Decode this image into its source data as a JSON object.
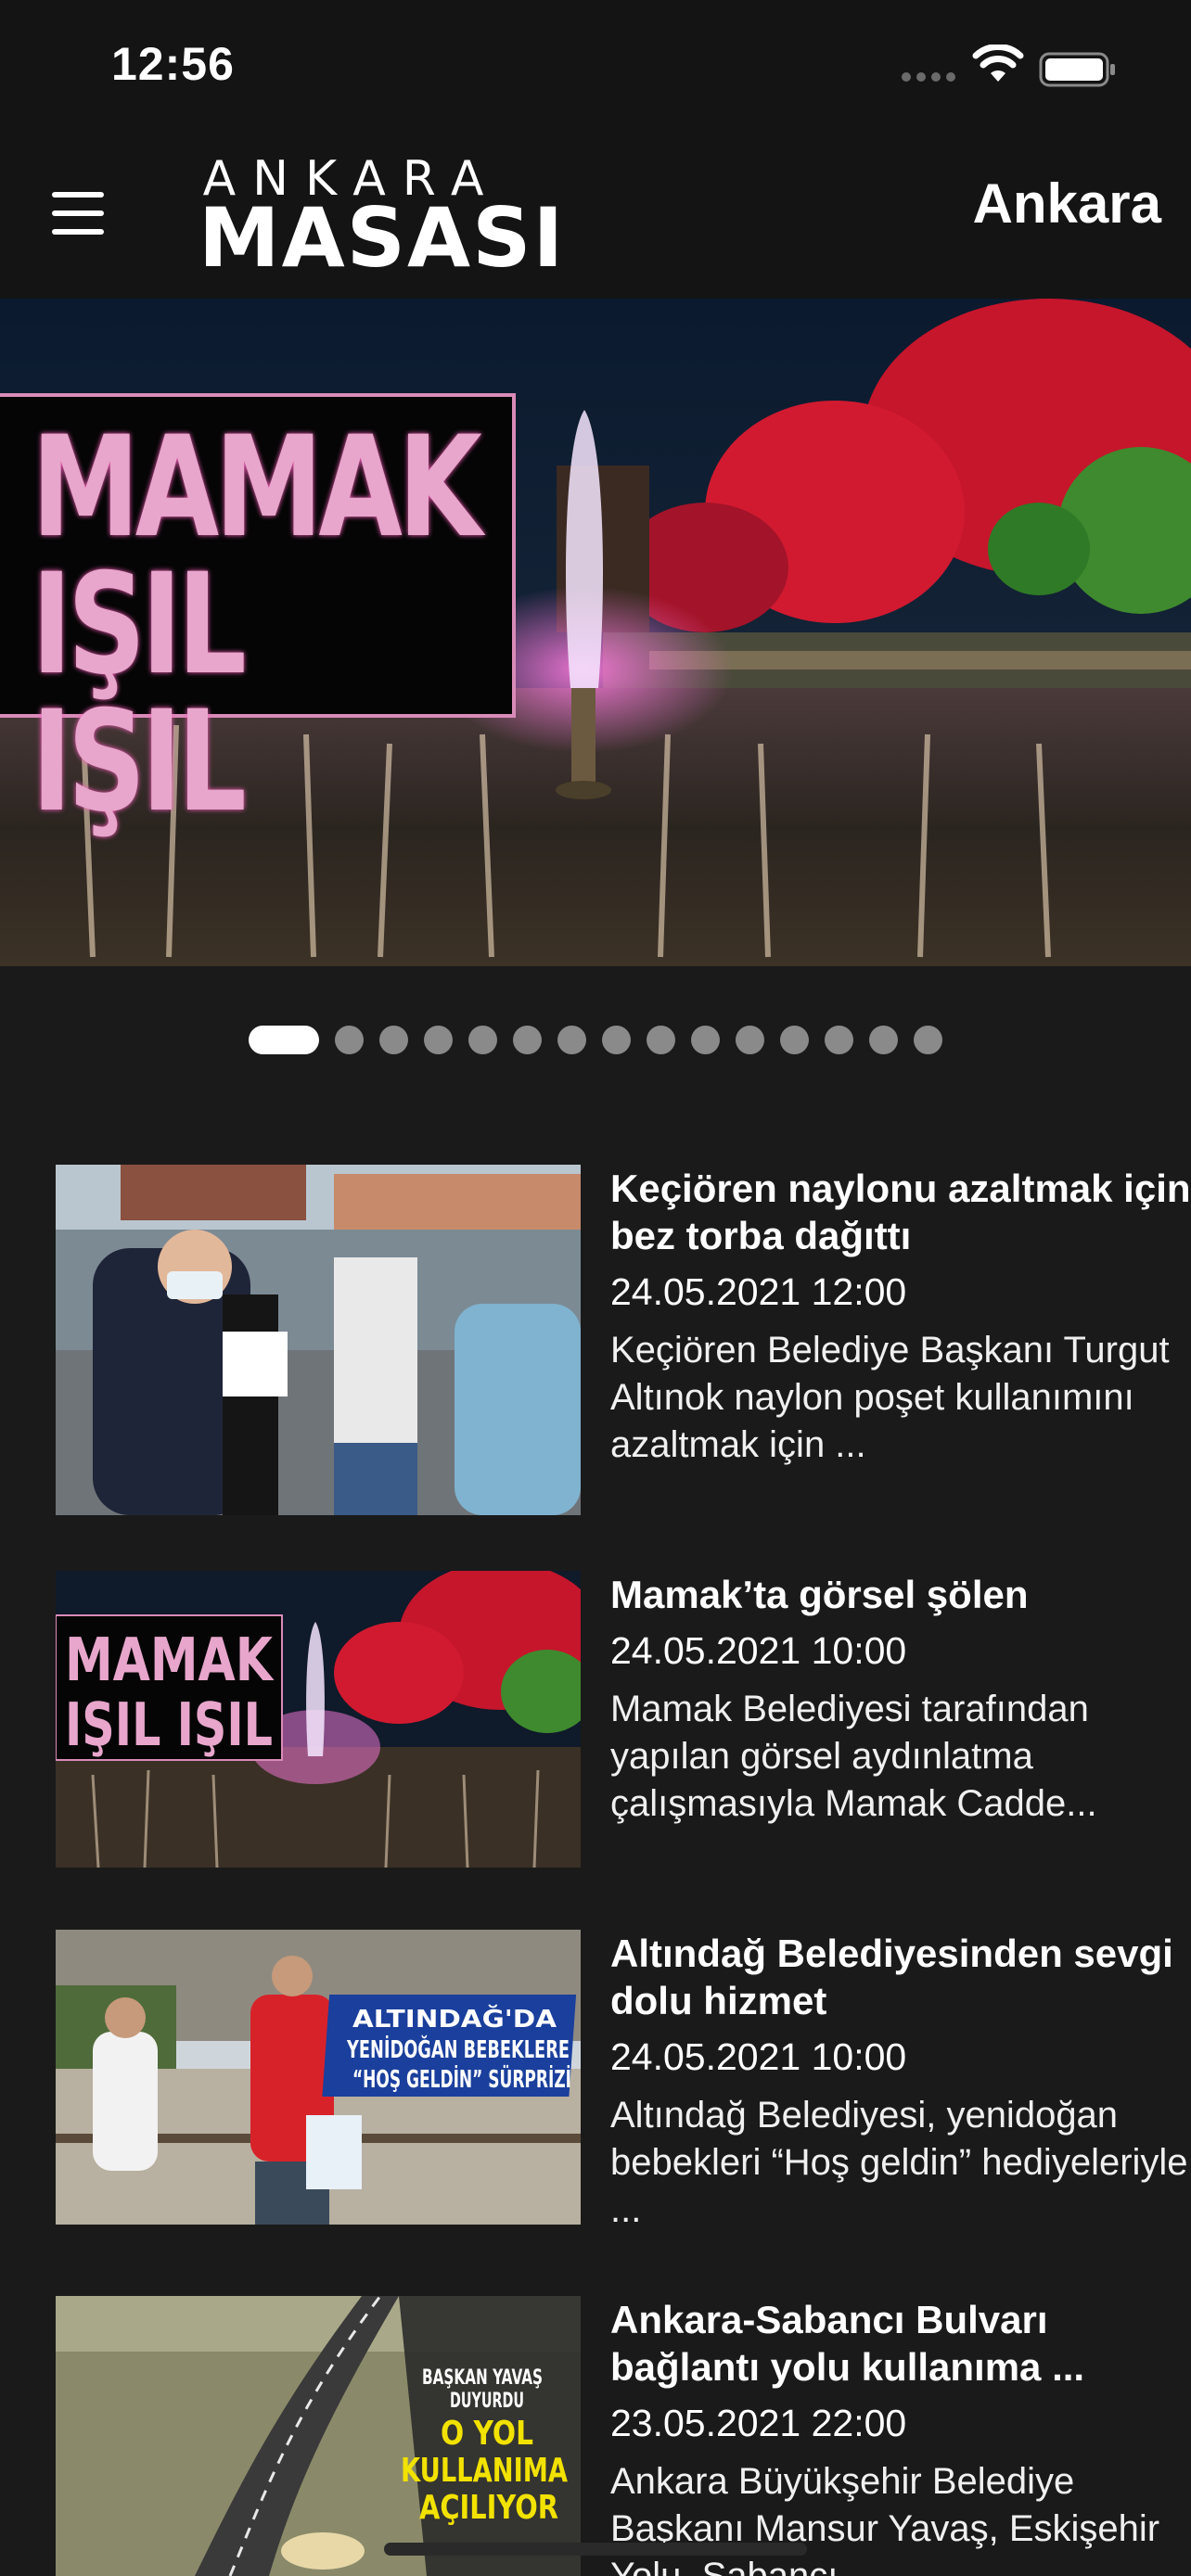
{
  "status_bar": {
    "time": "12:56"
  },
  "header": {
    "logo_top": "ANKARA",
    "logo_bottom": "MASASI",
    "city": "Ankara"
  },
  "hero": {
    "title": "MAMAK\nIŞIL IŞIL",
    "slide_count": 16,
    "active_slide": 1
  },
  "news": [
    {
      "title": "Keçiören naylonu azaltmak için bez torba dağıttı",
      "date": "24.05.2021 12:00",
      "desc": "Keçiören Belediye Başkanı Turgut Altınok naylon poşet kullanımını azaltmak için ..."
    },
    {
      "title": "Mamak’ta görsel şölen",
      "date": "24.05.2021 10:00",
      "desc": "Mamak Belediyesi tarafından yapılan görsel aydınlatma çalışmasıyla Mamak Cadde...",
      "thumb_text": "MAMAK\nIŞIL IŞIL"
    },
    {
      "title": "Altındağ Belediyesinden sevgi dolu hizmet",
      "date": "24.05.2021 10:00",
      "desc": "Altındağ Belediyesi, yenidoğan bebekleri “Hoş geldin” hediyeleriyle ...",
      "thumb_text": "ALTINDAĞ'DA\nYENİDOĞAN BEBEKLERE\n“HOŞ GELDİN” SÜRPRİZİ"
    },
    {
      "title": "Ankara-Sabancı Bulvarı bağlantı yolu kullanıma ...",
      "date": "23.05.2021 22:00",
      "desc": "Ankara Büyükşehir Belediye Başkanı Mansur Yavaş, Eskişehir Yolu, Sabancı",
      "thumb_text_1": "BAŞKAN YAVAŞ\nDUYURDU",
      "thumb_text_2": "O YOL\nKULLANIMA\nAÇILIYOR"
    }
  ],
  "colors": {
    "background": "#1a1a1a",
    "header": "#141414",
    "accent_pink": "#e8a6cc",
    "accent_yellow": "#f2e200"
  },
  "icons": [
    "menu-icon",
    "wifi-icon",
    "battery-icon",
    "signal-icon"
  ]
}
